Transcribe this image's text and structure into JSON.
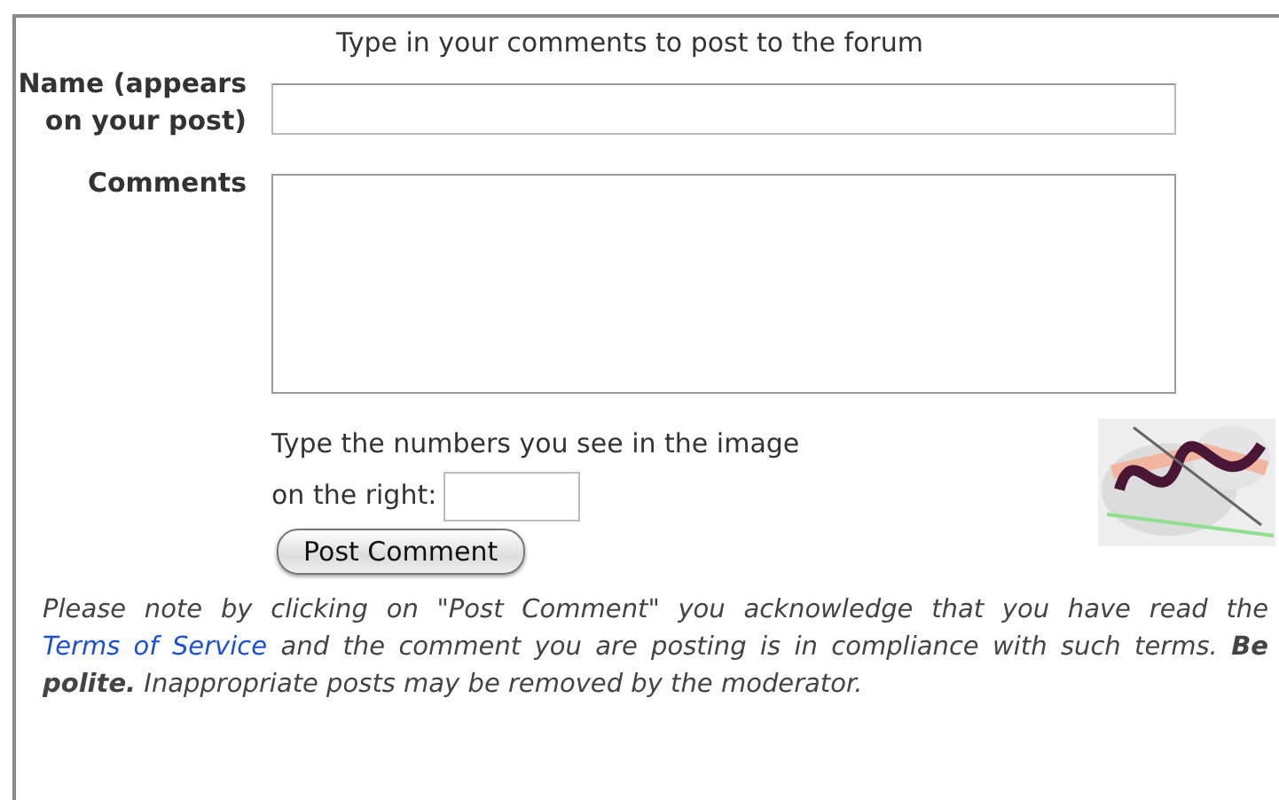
{
  "heading": "Type in your comments to post to the forum",
  "fields": [
    {
      "kind": "line",
      "label": "Name (appears on your post)"
    },
    {
      "kind": "area",
      "label": "Comments"
    }
  ],
  "captcha": {
    "prompt": "Type the numbers you see in the image on the right:"
  },
  "submit": "Post Comment",
  "note": {
    "before": "Please note by clicking on \"Post Comment\" you acknowledge that you have read the",
    "link": "Terms of Service",
    "after": "and the comment you are posting is in compliance with such terms. **Be polite.** Inappropriate posts may be removed by the moderator."
  }
}
